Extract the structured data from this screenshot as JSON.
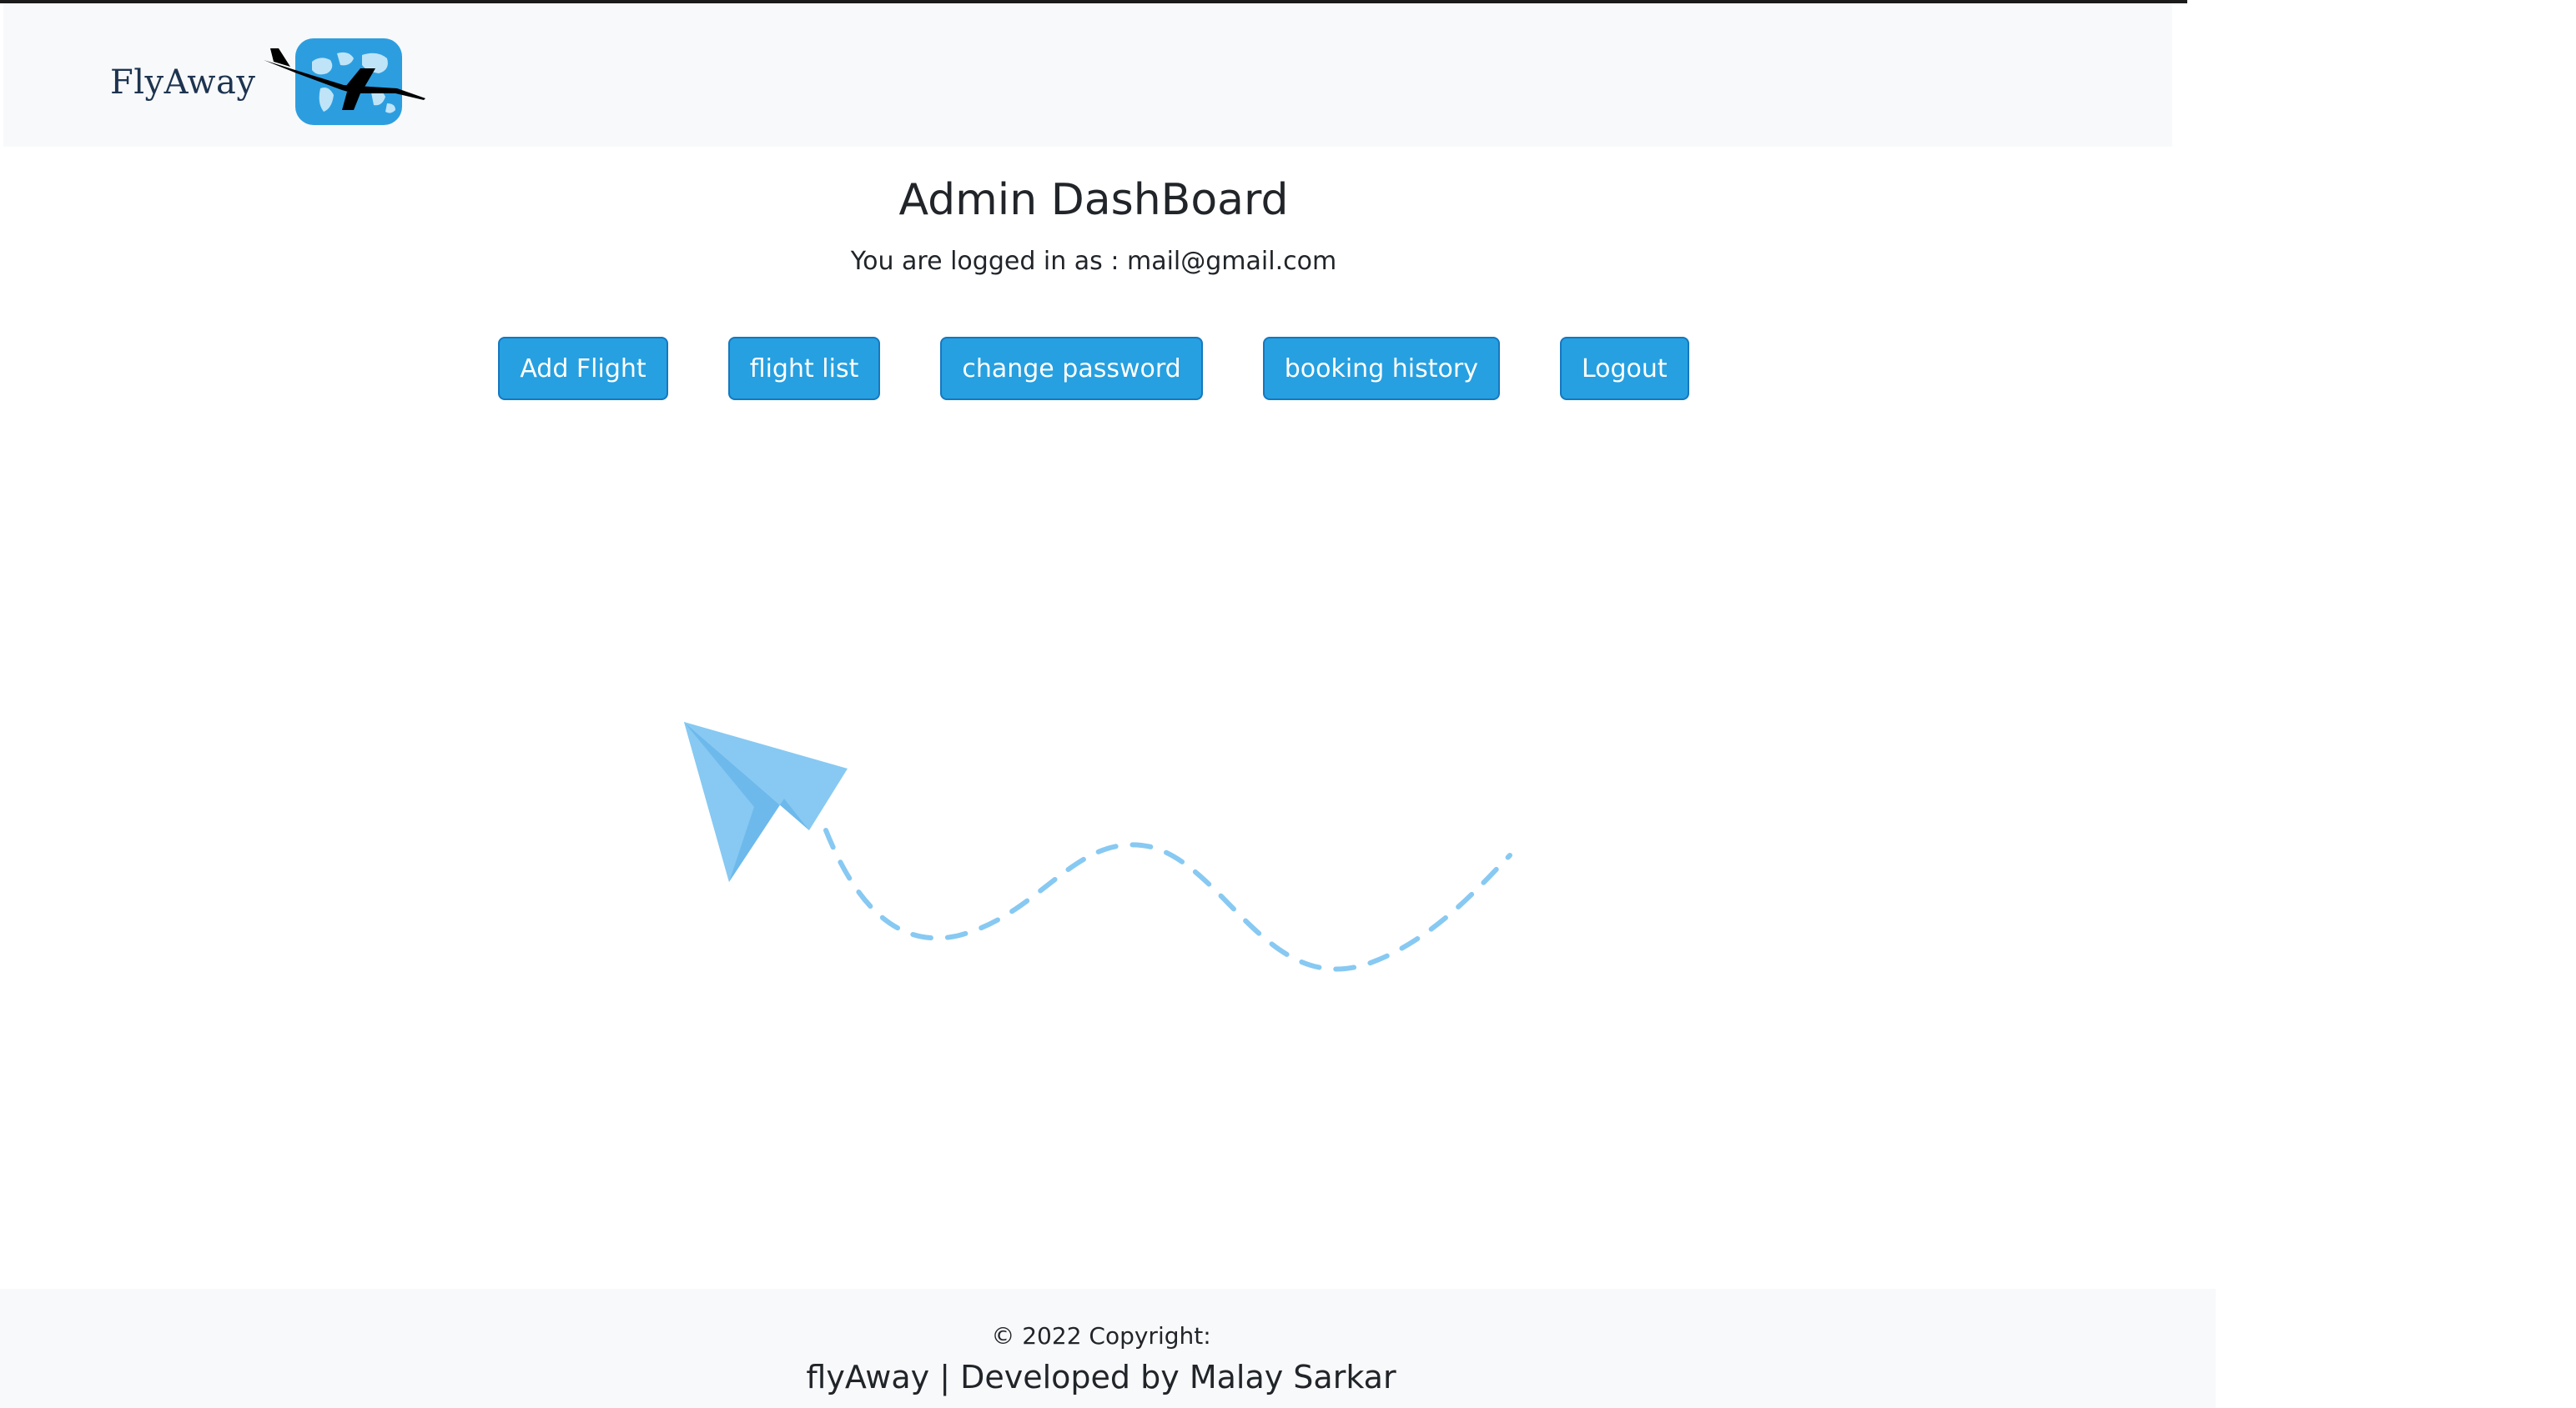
{
  "navbar": {
    "brand": "FlyAway",
    "logo_icon": "airplane-globe-logo"
  },
  "main": {
    "title": "Admin DashBoard",
    "logged_in_text": "You are logged in as : mail@gmail.com"
  },
  "buttons": {
    "add_flight": "Add Flight",
    "flight_list": "flight list",
    "change_password": "change password",
    "booking_history": "booking history",
    "logout": "Logout"
  },
  "footer": {
    "copyright": "© 2022 Copyright:",
    "credits": "flyAway | Developed by Malay Sarkar"
  },
  "colors": {
    "button_bg": "#26a0e0",
    "navbar_bg": "#f8f9fa",
    "illustration": "#87c9f2"
  },
  "illustration": {
    "icon": "paper-plane-icon"
  }
}
